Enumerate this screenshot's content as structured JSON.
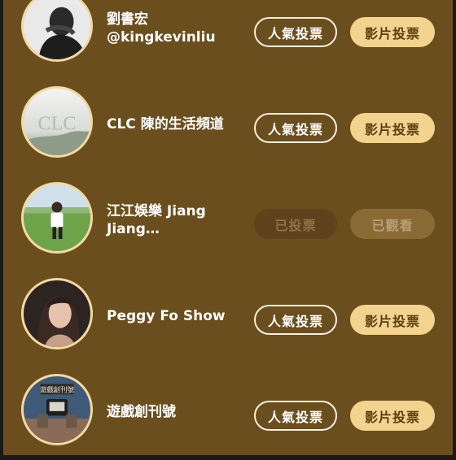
{
  "creators": [
    {
      "name_line1": "劉書宏",
      "name_line2": "@kingkevinliu",
      "popularity_label": "人氣投票",
      "video_label": "影片投票",
      "voted": false
    },
    {
      "name_line1": "CLC 陳的生活頻道",
      "name_line2": "",
      "popularity_label": "人氣投票",
      "video_label": "影片投票",
      "voted": false,
      "avatar_text": "CLC"
    },
    {
      "name_line1": "江江娛樂 Jiang",
      "name_line2": "Jiang…",
      "popularity_label": "已投票",
      "video_label": "已觀看",
      "voted": true
    },
    {
      "name_line1": "Peggy Fo Show",
      "name_line2": "",
      "popularity_label": "人氣投票",
      "video_label": "影片投票",
      "voted": false
    },
    {
      "name_line1": "遊戲創刊號",
      "name_line2": "",
      "popularity_label": "人氣投票",
      "video_label": "影片投票",
      "voted": false,
      "avatar_text": "遊戲創刊號"
    }
  ],
  "colors": {
    "panel": "#6b4e1e",
    "avatar_border": "#f3d9a2",
    "video_button": "#f3d38e",
    "disabled_button": "#5d431b"
  }
}
